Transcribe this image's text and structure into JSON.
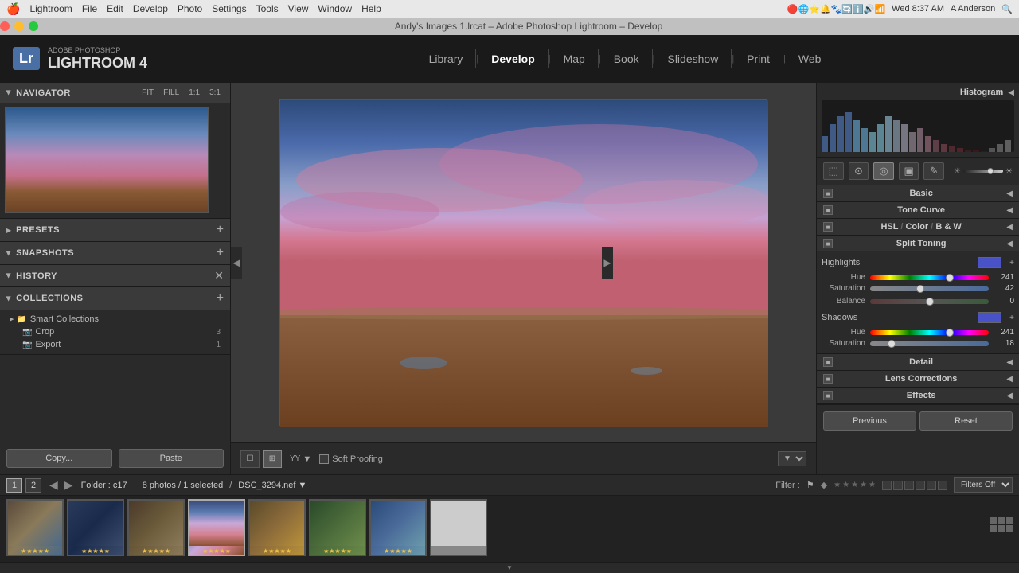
{
  "system": {
    "apple": "🍎",
    "menu": [
      "Lightroom",
      "File",
      "Edit",
      "Develop",
      "Photo",
      "Settings",
      "Tools",
      "View",
      "Window",
      "Help"
    ],
    "time": "Wed 8:37 AM",
    "user": "A Anderson",
    "title_bar": "Andy's Images 1.lrcat – Adobe Photoshop Lightroom – Develop"
  },
  "window_controls": {
    "close": "×",
    "min": "–",
    "max": "+"
  },
  "app": {
    "brand_top": "ADOBE PHOTOSHOP",
    "brand_bottom": "LIGHTROOM 4",
    "lr_abbr": "Lr"
  },
  "nav_items": [
    {
      "label": "Library",
      "active": false
    },
    {
      "label": "Develop",
      "active": true
    },
    {
      "label": "Map",
      "active": false
    },
    {
      "label": "Book",
      "active": false
    },
    {
      "label": "Slideshow",
      "active": false
    },
    {
      "label": "Print",
      "active": false
    },
    {
      "label": "Web",
      "active": false
    }
  ],
  "left_panel": {
    "navigator": {
      "title": "Navigator",
      "fit_label": "FIT",
      "fill_label": "FILL",
      "zoom1": "1:1",
      "zoom3": "3:1"
    },
    "presets": {
      "title": "Presets"
    },
    "snapshots": {
      "title": "Snapshots"
    },
    "history": {
      "title": "History"
    },
    "collections": {
      "title": "Collections",
      "items": [
        {
          "name": "Smart Collections",
          "type": "folder",
          "count": ""
        },
        {
          "name": "Crop",
          "type": "collection",
          "count": "3"
        },
        {
          "name": "Export",
          "type": "collection",
          "count": "1"
        }
      ]
    },
    "copy_btn": "Copy...",
    "paste_btn": "Paste"
  },
  "right_panel": {
    "histogram": {
      "title": "Histogram"
    },
    "tools": {
      "crop": "⬜",
      "spot": "○",
      "redeye": "◎",
      "gradient": "▣",
      "brush": "–"
    },
    "sections": [
      {
        "id": "basic",
        "title": "Basic"
      },
      {
        "id": "tone_curve",
        "title": "Tone Curve"
      },
      {
        "id": "hsl",
        "title": "HSL / Color / B&W"
      },
      {
        "id": "split_toning",
        "title": "Split Toning"
      },
      {
        "id": "detail",
        "title": "Detail"
      },
      {
        "id": "lens",
        "title": "Lens Corrections"
      },
      {
        "id": "effects",
        "title": "Effects"
      }
    ],
    "split_toning": {
      "highlights_label": "Highlights",
      "shadows_label": "Shadows",
      "hue_label": "Hue",
      "saturation_label": "Saturation",
      "balance_label": "Balance",
      "highlights_hue": 241,
      "highlights_sat": 42,
      "balance": 0,
      "shadows_hue": 241,
      "shadows_sat": 18,
      "highlights_hue_pct": 67,
      "highlights_sat_pct": 42,
      "balance_pct": 50,
      "shadows_hue_pct": 67,
      "shadows_sat_pct": 18,
      "highlights_color": "#4a52c8",
      "shadows_color": "#4a52c8"
    },
    "previous_btn": "Previous",
    "reset_btn": "Reset"
  },
  "bottom_toolbar": {
    "crop_view": "☐",
    "view_label": "YY",
    "proof_label": "Soft Proofing"
  },
  "filmstrip": {
    "folder": "Folder : c17",
    "photo_count": "8 photos / 1 selected",
    "file_name": "DSC_3294.nef",
    "filter_label": "Filter :",
    "filters_off": "Filters Off",
    "pages": [
      "1",
      "2"
    ],
    "thumbs": [
      {
        "id": 1,
        "stars": 5
      },
      {
        "id": 2,
        "stars": 5
      },
      {
        "id": 3,
        "stars": 5
      },
      {
        "id": 4,
        "stars": 5,
        "selected": true
      },
      {
        "id": 5,
        "stars": 5
      },
      {
        "id": 6,
        "stars": 5
      },
      {
        "id": 7,
        "stars": 5
      },
      {
        "id": 8,
        "stars": 0
      }
    ]
  }
}
